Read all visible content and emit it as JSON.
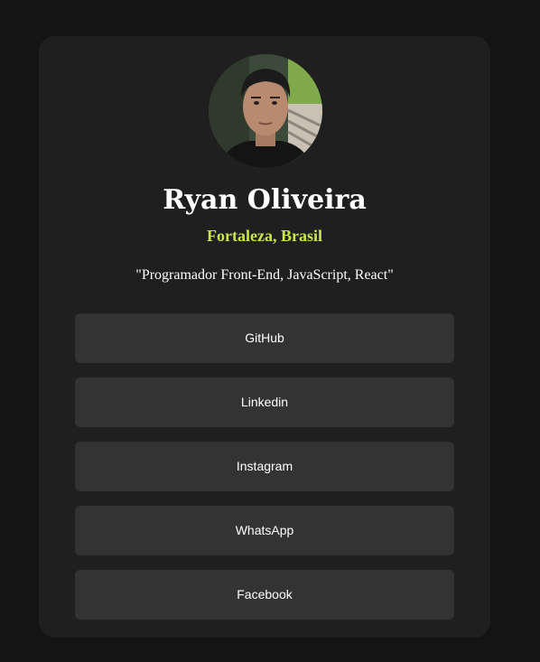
{
  "profile": {
    "name": "Ryan Oliveira",
    "location": "Fortaleza, Brasil",
    "bio": "\"Programador Front-End, JavaScript, React\""
  },
  "links": [
    {
      "label": "GitHub"
    },
    {
      "label": "Linkedin"
    },
    {
      "label": "Instagram"
    },
    {
      "label": "WhatsApp"
    },
    {
      "label": "Facebook"
    }
  ],
  "colors": {
    "page_bg": "#141414",
    "card_bg": "#1f1f1f",
    "button_bg": "#333333",
    "accent": "#c8e64b",
    "text": "#ffffff"
  }
}
